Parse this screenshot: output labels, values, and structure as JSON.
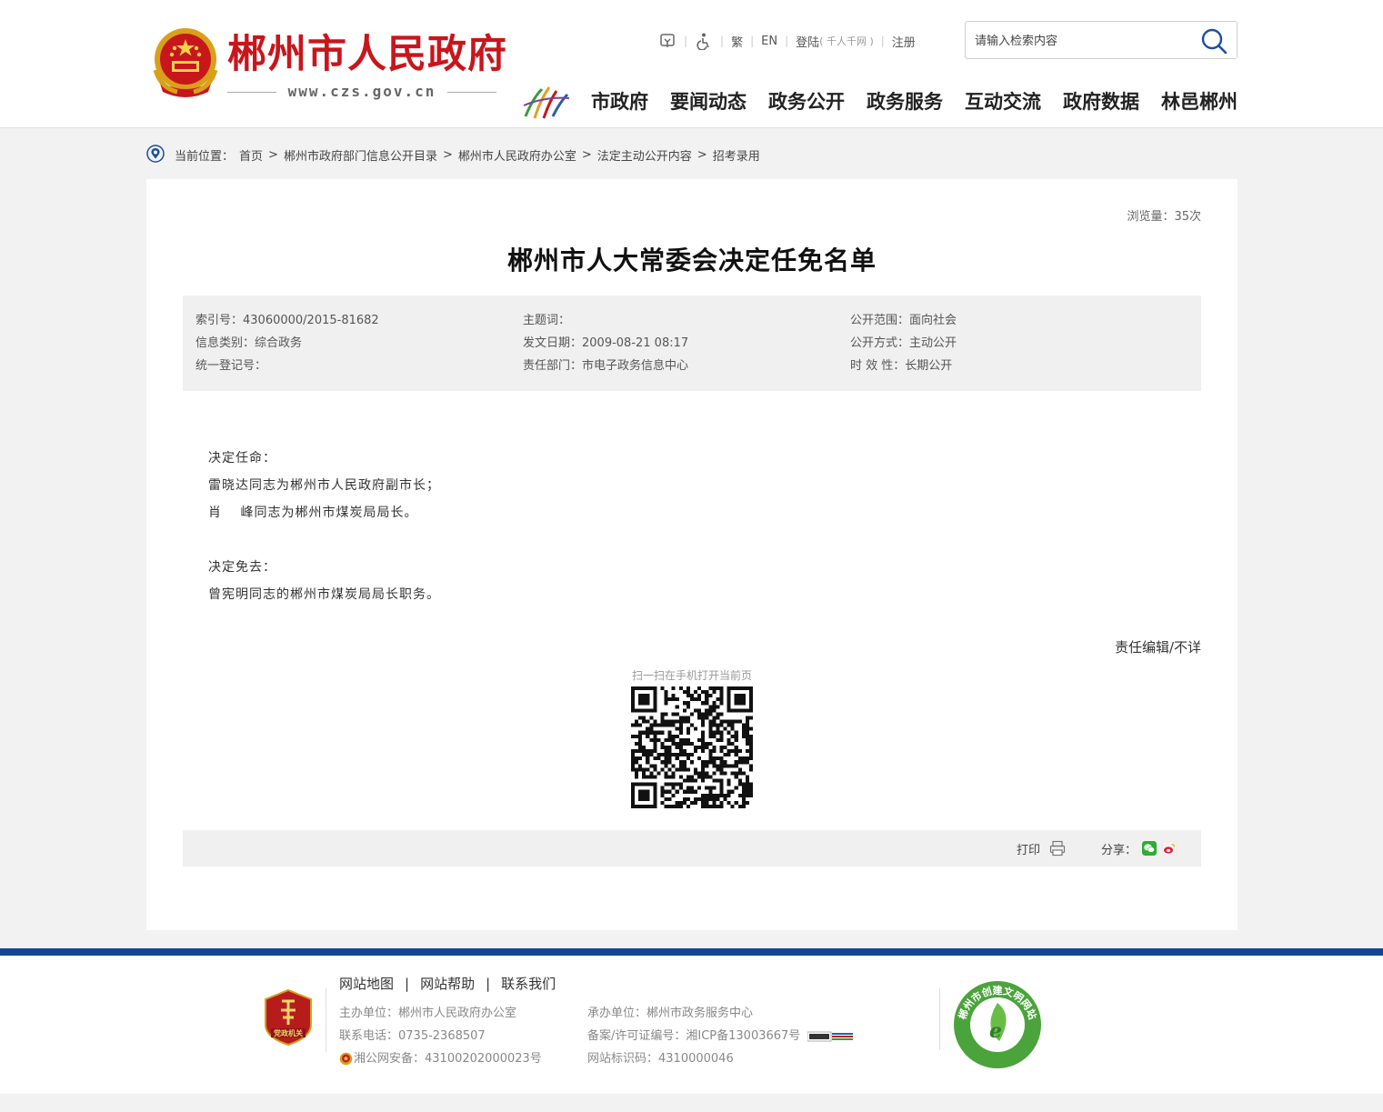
{
  "header": {
    "site_name": "郴州市人民政府",
    "site_url": "www.czs.gov.cn",
    "tools": {
      "traditional": "繁",
      "english": "EN",
      "login": "登陆",
      "login_note": "( 千人千网 )",
      "register": "注册"
    },
    "search_placeholder": "请输入检索内容",
    "nav": [
      "市政府",
      "要闻动态",
      "政务公开",
      "政务服务",
      "互动交流",
      "政府数据",
      "林邑郴州"
    ]
  },
  "breadcrumb": {
    "label": "当前位置：",
    "items": [
      "首页",
      "郴州市政府部门信息公开目录",
      "郴州市人民政府办公室",
      "法定主动公开内容",
      "招考录用"
    ]
  },
  "article": {
    "views": "浏览量：35次",
    "title": "郴州市人大常委会决定任免名单",
    "meta": {
      "index_no": "索引号：43060000/2015-81682",
      "subject": "主题词：",
      "scope": "公开范围：面向社会",
      "category": "信息类别：综合政务",
      "date": "发文日期：2009-08-21 08:17",
      "method": "公开方式：主动公开",
      "reg_no": "统一登记号：",
      "dept": "责任部门：市电子政务信息中心",
      "validity": "时 效 性：长期公开"
    },
    "body": {
      "appoint_head": "决定任命：",
      "appoint_1": "雷晓达同志为郴州市人民政府副市长；",
      "appoint_2": "肖　 峰同志为郴州市煤炭局局长。",
      "remove_head": "决定免去：",
      "remove_1": "曾宪明同志的郴州市煤炭局局长职务。"
    },
    "editor": "责任编辑/不详",
    "qr_label": "扫一扫在手机打开当前页",
    "print": "打印",
    "share": "分享："
  },
  "footer": {
    "links": [
      "网站地图",
      "网站帮助",
      "联系我们"
    ],
    "host": "主办单位：郴州市人民政府办公室",
    "phone": "联系电话：0735-2368507",
    "police": "湘公网安备：43100202000023号",
    "operator": "承办单位：郴州市政务服务中心",
    "icp": "备案/许可证编号：湘ICP备13003667号",
    "site_code": "网站标识码：4310000046",
    "badge_text": "党政机关",
    "civil_text": "郴州市创建文明网站"
  },
  "colors": {
    "brand_red": "#c8161d",
    "footer_blue": "#154597",
    "meta_bg": "#f0f0f0"
  }
}
